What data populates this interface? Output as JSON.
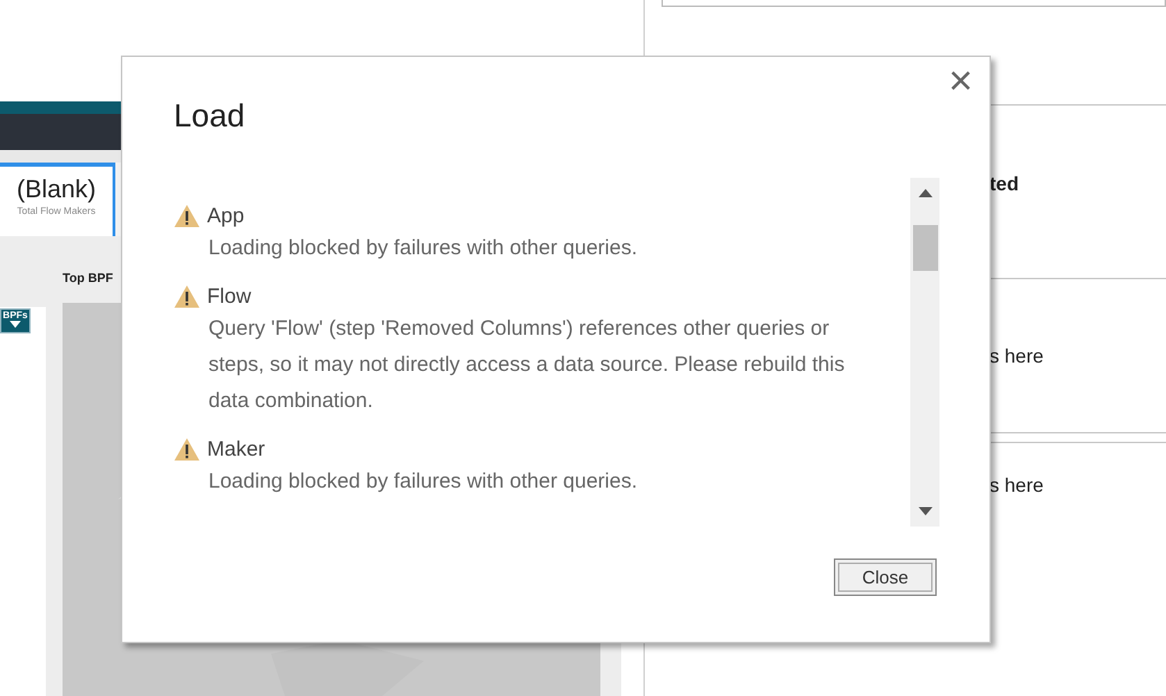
{
  "report": {
    "card": {
      "value": "(Blank)",
      "label": "Total Flow Makers"
    },
    "visual_title": "Top BPF",
    "bpf_button": "BPFs"
  },
  "filter_pane": {
    "cards": [
      {
        "text": "ted",
        "bold": true
      },
      {
        "text": "s here",
        "bold": false
      },
      {
        "text": "s here",
        "bold": false
      }
    ]
  },
  "dialog": {
    "title": "Load",
    "close_icon": "×",
    "items": [
      {
        "name": "App",
        "message": "Loading blocked by failures with other queries."
      },
      {
        "name": "Flow",
        "message": "Query 'Flow' (step 'Removed Columns') references other queries or steps, so it may not directly access a data source. Please rebuild this data combination."
      },
      {
        "name": "Maker",
        "message": "Loading blocked by failures with other queries."
      }
    ],
    "button": "Close"
  }
}
